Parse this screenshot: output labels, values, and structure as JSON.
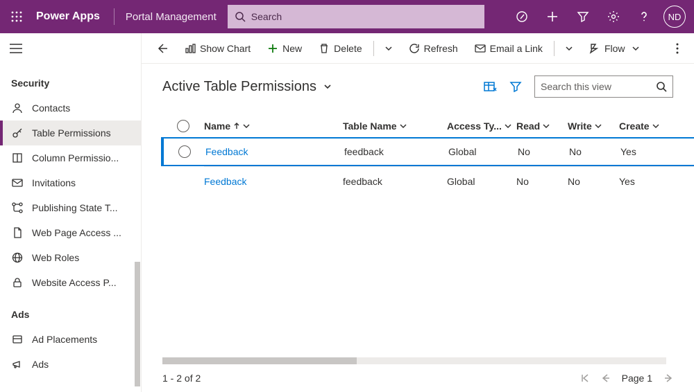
{
  "header": {
    "brand": "Power Apps",
    "area": "Portal Management",
    "search_placeholder": "Search",
    "user_initials": "ND"
  },
  "sidebar": {
    "groups": [
      {
        "label": "Security",
        "items": [
          {
            "label": "Contacts"
          },
          {
            "label": "Table Permissions",
            "selected": true
          },
          {
            "label": "Column Permissio..."
          },
          {
            "label": "Invitations"
          },
          {
            "label": "Publishing State T..."
          },
          {
            "label": "Web Page Access ..."
          },
          {
            "label": "Web Roles"
          },
          {
            "label": "Website Access P..."
          }
        ]
      },
      {
        "label": "Ads",
        "items": [
          {
            "label": "Ad Placements"
          },
          {
            "label": "Ads"
          }
        ]
      }
    ]
  },
  "cmdbar": {
    "back": "Back",
    "show_chart": "Show Chart",
    "new": "New",
    "delete": "Delete",
    "refresh": "Refresh",
    "email_link": "Email a Link",
    "flow": "Flow"
  },
  "view": {
    "title": "Active Table Permissions",
    "search_placeholder": "Search this view"
  },
  "grid": {
    "columns": {
      "name": "Name",
      "table": "Table Name",
      "access": "Access Ty...",
      "read": "Read",
      "write": "Write",
      "create": "Create"
    },
    "rows": [
      {
        "name": "Feedback",
        "table": "feedback",
        "access": "Global",
        "read": "No",
        "write": "No",
        "create": "Yes",
        "selected": true
      },
      {
        "name": "Feedback",
        "table": "feedback",
        "access": "Global",
        "read": "No",
        "write": "No",
        "create": "Yes"
      }
    ]
  },
  "footer": {
    "count": "1 - 2 of 2",
    "page": "Page 1"
  }
}
